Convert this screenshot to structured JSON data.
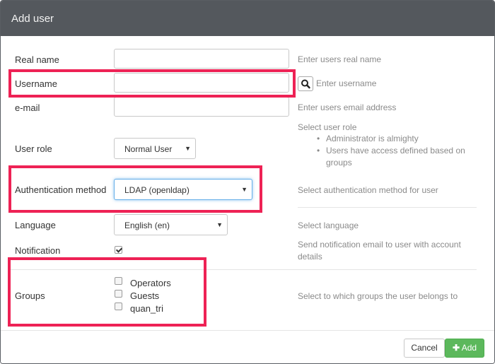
{
  "dialog": {
    "title": "Add user"
  },
  "fields": {
    "real_name": {
      "label": "Real name",
      "value": "",
      "help": "Enter users real name"
    },
    "username": {
      "label": "Username",
      "value": "",
      "help": "Enter username"
    },
    "email": {
      "label": "e-mail",
      "value": "",
      "help": "Enter users email address"
    },
    "user_role": {
      "label": "User role",
      "selected": "Normal User",
      "help_title": "Select user role",
      "help_items": [
        "Administrator is almighty",
        "Users have access defined based on groups"
      ]
    },
    "auth_method": {
      "label": "Authentication method",
      "selected": "LDAP (openldap)",
      "help": "Select authentication method for user"
    },
    "language": {
      "label": "Language",
      "selected": "English (en)",
      "help": "Select language"
    },
    "notification": {
      "label": "Notification",
      "checked": true,
      "help": "Send notification email to user with account details"
    },
    "groups": {
      "label": "Groups",
      "items": [
        {
          "name": "Operators",
          "checked": false
        },
        {
          "name": "Guests",
          "checked": false
        },
        {
          "name": "quan_tri",
          "checked": false
        }
      ],
      "help": "Select to which groups the user belongs to"
    }
  },
  "footer": {
    "cancel_label": "Cancel",
    "add_label": "Add",
    "add_icon": "plus-icon"
  },
  "colors": {
    "header_bg": "#54585d",
    "highlight": "#ee2255",
    "add_button": "#5cb85c"
  }
}
